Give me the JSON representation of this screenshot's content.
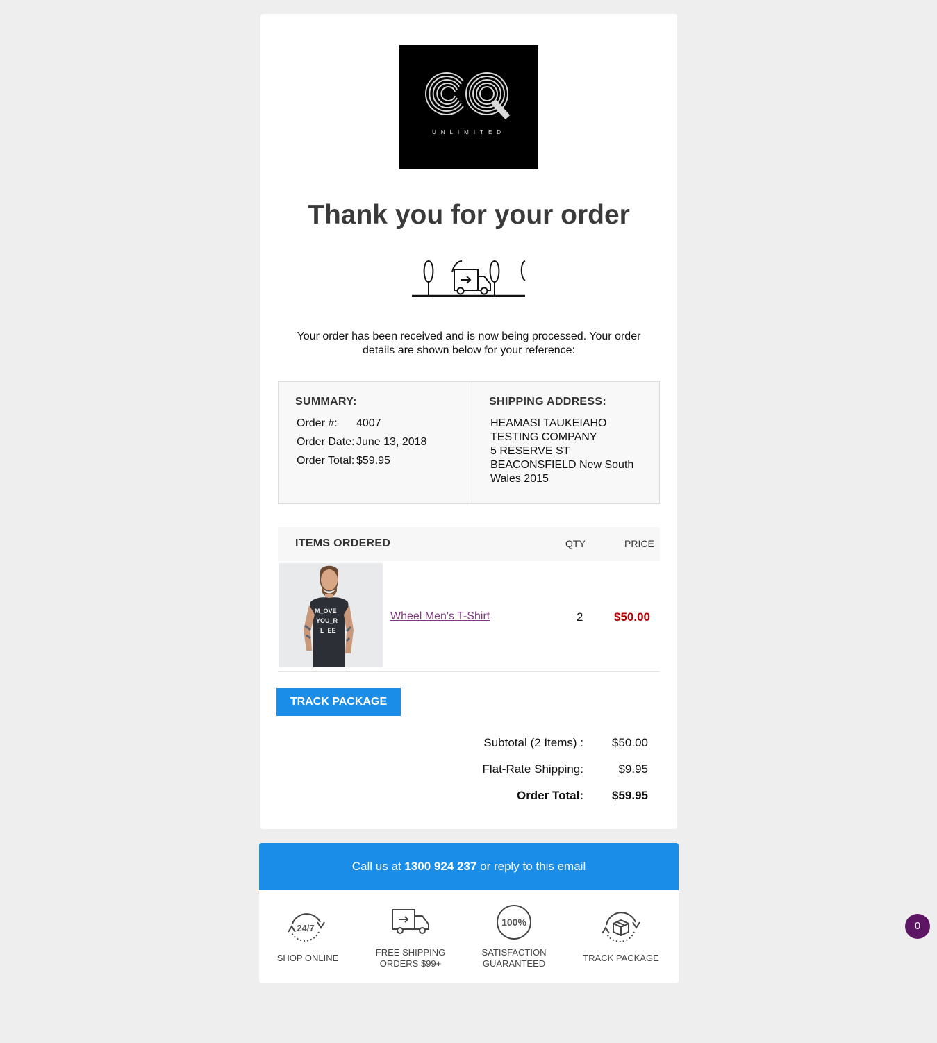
{
  "brand": {
    "logo_text": "UNLIMITED",
    "logo_letters": "CQ"
  },
  "heading": "Thank you for your order",
  "intro": "Your order has been received and is now being processed. Your order details are shown below for your reference:",
  "summary": {
    "title": "SUMMARY:",
    "order_no_label": "Order #:",
    "order_no": "4007",
    "date_label": "Order Date:",
    "date": "June 13, 2018",
    "total_label": "Order Total:",
    "total": "$59.95"
  },
  "shipping": {
    "title": "SHIPPING ADDRESS:",
    "lines": [
      "HEAMASI TAUKEIAHO",
      "TESTING COMPANY",
      "5 RESERVE ST",
      "BEACONSFIELD New South",
      "Wales 2015"
    ]
  },
  "items": {
    "title": "ITEMS ORDERED",
    "qty_header": "QTY",
    "price_header": "PRICE",
    "rows": [
      {
        "name": "Wheel Men's T-Shirt",
        "qty": "2",
        "price": "$50.00",
        "shirt_text": [
          "M_OVE",
          "YOU_R",
          "L_EE"
        ]
      }
    ]
  },
  "track_button": "TRACK PACKAGE",
  "totals": {
    "subtotal_label": "Subtotal (2 Items) :",
    "subtotal": "$50.00",
    "shipping_label": "Flat-Rate Shipping:",
    "shipping": "$9.95",
    "total_label": "Order Total:",
    "total": "$59.95"
  },
  "contact": {
    "prefix": "Call us at",
    "phone": "1300 924 237",
    "suffix": "or reply to this email"
  },
  "features": [
    {
      "icon": "24-7-icon",
      "icon_text": "24/7",
      "line1": "SHOP ONLINE",
      "line2": ""
    },
    {
      "icon": "delivery-truck-icon",
      "icon_text": "",
      "line1": "FREE SHIPPING",
      "line2": "ORDERS $99+"
    },
    {
      "icon": "100-percent-icon",
      "icon_text": "100%",
      "line1": "SATISFACTION",
      "line2": "GUARANTEED"
    },
    {
      "icon": "package-cycle-icon",
      "icon_text": "",
      "line1": "TRACK PACKAGE",
      "line2": ""
    }
  ],
  "notification_count": "0",
  "colors": {
    "accent": "#1a8de9",
    "price": "#b30000",
    "link": "#7d3a7e",
    "badge": "#5c1664"
  }
}
